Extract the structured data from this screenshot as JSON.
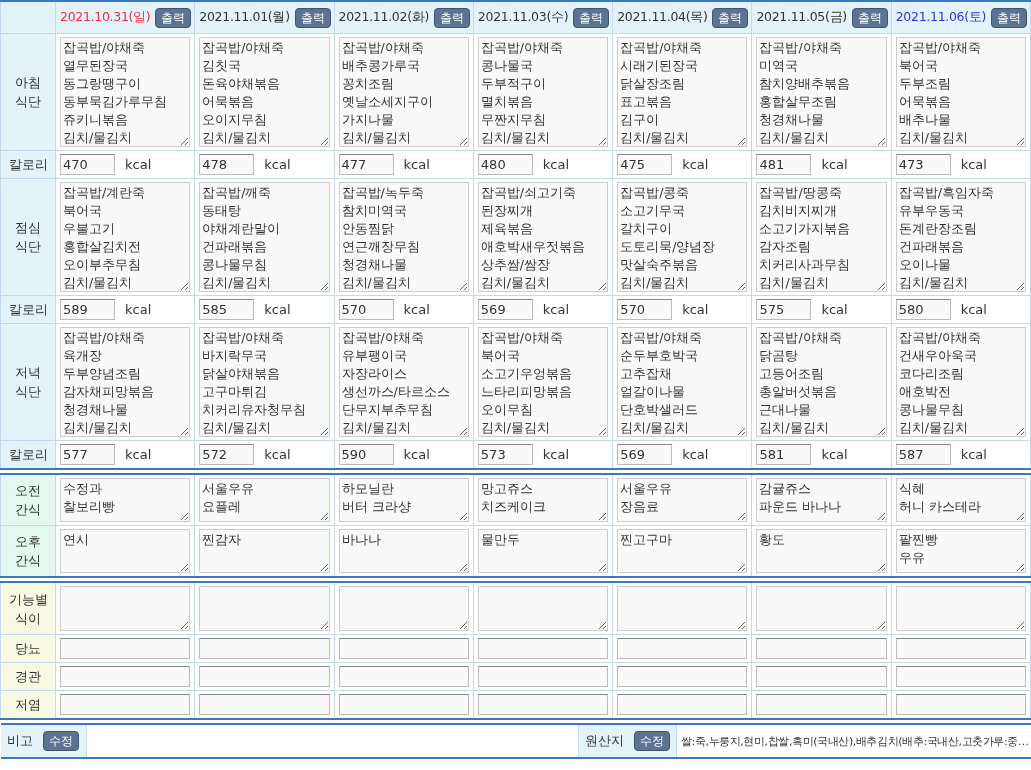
{
  "days": [
    {
      "date": "2021.10.31(일)",
      "kind": "sunday",
      "button": "출력"
    },
    {
      "date": "2021.11.01(월)",
      "kind": "weekday",
      "button": "출력"
    },
    {
      "date": "2021.11.02(화)",
      "kind": "weekday",
      "button": "출력"
    },
    {
      "date": "2021.11.03(수)",
      "kind": "weekday",
      "button": "출력"
    },
    {
      "date": "2021.11.04(목)",
      "kind": "weekday",
      "button": "출력"
    },
    {
      "date": "2021.11.05(금)",
      "kind": "weekday",
      "button": "출력"
    },
    {
      "date": "2021.11.06(토)",
      "kind": "saturday",
      "button": "출력"
    }
  ],
  "meals": [
    {
      "label": [
        "아침",
        "식단"
      ],
      "calorie_label": "칼로리",
      "menus": [
        [
          "잡곡밥/야채죽",
          "열무된장국",
          "동그랑땡구이",
          "동부묵김가루무침",
          "쥬키니볶음",
          "김치/물김치"
        ],
        [
          "잡곡밥/야채죽",
          "김칫국",
          "돈육야채볶음",
          "어묵볶음",
          "오이지무침",
          "김치/물김치"
        ],
        [
          "잡곡밥/야채죽",
          "배추콩가루국",
          "꽁치조림",
          "옛날소세지구이",
          "가지나물",
          "김치/물김치"
        ],
        [
          "잡곡밥/야채죽",
          "콩나물국",
          "두부적구이",
          "멸치볶음",
          "무짠지무침",
          "김치/물김치"
        ],
        [
          "잡곡밥/야채죽",
          "시래기된장국",
          "닭살장조림",
          "표고볶음",
          "김구이",
          "김치/물김치"
        ],
        [
          "잡곡밥/야채죽",
          "미역국",
          "참치양배추볶음",
          "홍합살무조림",
          "청경채나물",
          "김치/물김치"
        ],
        [
          "잡곡밥/야채죽",
          "북어국",
          "두부조림",
          "어묵볶음",
          "배추나물",
          "김치/물김치"
        ]
      ],
      "calories": [
        {
          "value": "470",
          "unit": "kcal"
        },
        {
          "value": "478",
          "unit": "kcal"
        },
        {
          "value": "477",
          "unit": "kcal"
        },
        {
          "value": "480",
          "unit": "kcal"
        },
        {
          "value": "475",
          "unit": "kcal"
        },
        {
          "value": "481",
          "unit": "kcal"
        },
        {
          "value": "473",
          "unit": "kcal"
        }
      ]
    },
    {
      "label": [
        "점심",
        "식단"
      ],
      "calorie_label": "칼로리",
      "menus": [
        [
          "잡곡밥/계란죽",
          "북어국",
          "우불고기",
          "홍합살김치전",
          "오이부추무침",
          "김치/물김치"
        ],
        [
          "잡곡밥/깨죽",
          "동태탕",
          "야채계란말이",
          "건파래볶음",
          "콩나물무침",
          "김치/물김치"
        ],
        [
          "잡곡밥/녹두죽",
          "참치미역국",
          "안동찜닭",
          "연근깨장무침",
          "청경채나물",
          "김치/물김치"
        ],
        [
          "잡곡밥/쇠고기죽",
          "된장찌개",
          "제육볶음",
          "애호박새우젓볶음",
          "상추쌈/쌈장",
          "김치/물김치"
        ],
        [
          "잡곡밥/콩죽",
          "소고기무국",
          "갈치구이",
          "도토리묵/양념장",
          "맛살숙주볶음",
          "김치/물김치"
        ],
        [
          "잡곡밥/땅콩죽",
          "김치비지찌개",
          "소고기가지볶음",
          "감자조림",
          "치커리사과무침",
          "김치/물김치"
        ],
        [
          "잡곡밥/흑임자죽",
          "유부우동국",
          "돈계란장조림",
          "건파래볶음",
          "오이나물",
          "김치/물김치"
        ]
      ],
      "calories": [
        {
          "value": "589",
          "unit": "kcal"
        },
        {
          "value": "585",
          "unit": "kcal"
        },
        {
          "value": "570",
          "unit": "kcal"
        },
        {
          "value": "569",
          "unit": "kcal"
        },
        {
          "value": "570",
          "unit": "kcal"
        },
        {
          "value": "575",
          "unit": "kcal"
        },
        {
          "value": "580",
          "unit": "kcal"
        }
      ]
    },
    {
      "label": [
        "저녁",
        "식단"
      ],
      "calorie_label": "칼로리",
      "menus": [
        [
          "잡곡밥/야채죽",
          "육개장",
          "두부양념조림",
          "감자채피망볶음",
          "청경채나물",
          "김치/물김치"
        ],
        [
          "잡곡밥/야채죽",
          "바지락무국",
          "닭살야채볶음",
          "고구마튀김",
          "치커리유자청무침",
          "김치/물김치"
        ],
        [
          "잡곡밥/야채죽",
          "유부팽이국",
          "자장라이스",
          "생선까스/타르소스",
          "단무지부추무침",
          "김치/물김치"
        ],
        [
          "잡곡밥/야채죽",
          "북어국",
          "소고기우엉볶음",
          "느타리피망볶음",
          "오이무침",
          "김치/물김치"
        ],
        [
          "잡곡밥/야채죽",
          "순두부호박국",
          "고추잡채",
          "얼갈이나물",
          "단호박샐러드",
          "김치/물김치"
        ],
        [
          "잡곡밥/야채죽",
          "닭곰탕",
          "고등어조림",
          "총알버섯볶음",
          "근대나물",
          "김치/물김치"
        ],
        [
          "잡곡밥/야채죽",
          "건새우아욱국",
          "코다리조림",
          "애호박전",
          "콩나물무침",
          "김치/물김치"
        ]
      ],
      "calories": [
        {
          "value": "577",
          "unit": "kcal"
        },
        {
          "value": "572",
          "unit": "kcal"
        },
        {
          "value": "590",
          "unit": "kcal"
        },
        {
          "value": "573",
          "unit": "kcal"
        },
        {
          "value": "569",
          "unit": "kcal"
        },
        {
          "value": "581",
          "unit": "kcal"
        },
        {
          "value": "587",
          "unit": "kcal"
        }
      ]
    }
  ],
  "snacks": [
    {
      "label": [
        "오전",
        "간식"
      ],
      "items": [
        [
          "수정과",
          "찰보리빵"
        ],
        [
          "서울우유",
          "요플레"
        ],
        [
          "하모닐란",
          "버터 크라샹"
        ],
        [
          "망고쥬스",
          "치즈케이크"
        ],
        [
          "서울우유",
          "장음료"
        ],
        [
          "감귤쥬스",
          "파운드 바나나"
        ],
        [
          "식혜",
          "허니 카스테라"
        ]
      ]
    },
    {
      "label": [
        "오후",
        "간식"
      ],
      "items": [
        [
          "연시"
        ],
        [
          "찐감자"
        ],
        [
          "바나나"
        ],
        [
          "물만두"
        ],
        [
          "찐고구마"
        ],
        [
          "황도"
        ],
        [
          "팥찐빵",
          "우유"
        ]
      ]
    }
  ],
  "diets": [
    {
      "label": [
        "기능별",
        "식이"
      ],
      "kind": "area"
    },
    {
      "label": [
        "당뇨"
      ],
      "kind": "line"
    },
    {
      "label": [
        "경관"
      ],
      "kind": "line"
    },
    {
      "label": [
        "저염"
      ],
      "kind": "line"
    }
  ],
  "footer": {
    "remark_label": "비고",
    "remark_button": "수정",
    "origin_label": "원산지",
    "origin_button": "수정",
    "origin_text": "쌀:죽,누룽지,현미,찹쌀,흑미(국내산),배추김치(배추:국내산,고춧가루:중…"
  }
}
